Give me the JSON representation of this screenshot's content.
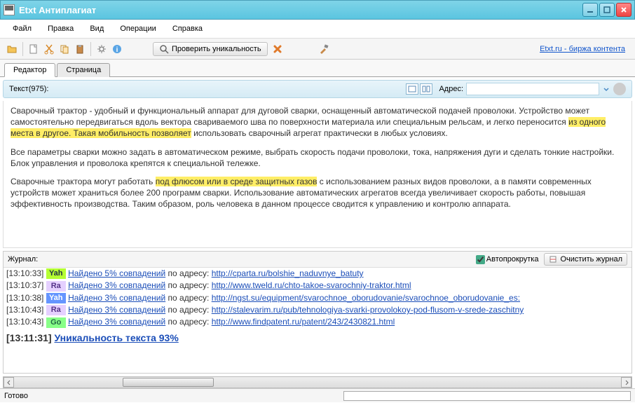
{
  "title": "Etxt Антиплагиат",
  "menubar": [
    "Файл",
    "Правка",
    "Вид",
    "Операции",
    "Справка"
  ],
  "toolbar": {
    "check_label": "Проверить уникальность",
    "etxt_link": "Etxt.ru - биржа контента"
  },
  "tabs": [
    {
      "label": "Редактор",
      "active": true
    },
    {
      "label": "Страница",
      "active": false
    }
  ],
  "editor_header": {
    "text_count": "Текст(975):",
    "addr_label": "Адрес:",
    "addr_value": ""
  },
  "editor_text": {
    "p1_a": "Сварочный трактор - удобный и функциональный аппарат для дуговой сварки, оснащенный автоматической подачей проволоки. Устройство может самостоятельно передвигаться вдоль вектора свариваемого шва по поверхности материала или специальным рельсам, и легко переносится ",
    "p1_hl": "из одного места в другое. Такая мобильность позволяет",
    "p1_b": " использовать сварочный агрегат практически в любых условиях.",
    "p2": "Все параметры сварки можно задать в автоматическом режиме, выбрать скорость подачи проволоки, тока, напряжения дуги и сделать тонкие настройки. Блок управления и проволока крепятся к специальной тележке.",
    "p3_a": "Сварочные трактора могут работать ",
    "p3_hl": "под флюсом или в среде защитных газов",
    "p3_b": " с использованием разных видов проволоки, а в памяти современных устройств может храниться более 200 программ сварки. Использование автоматических агрегатов всегда увеличивает скорость работы, повышая эффективность производства. Таким образом, роль человека в данном процессе сводится к управлению и контролю аппарата."
  },
  "log": {
    "label": "Журнал:",
    "autoscroll_label": "Автопрокрутка",
    "clear_label": "Очистить журнал",
    "по_адресу": " по адресу: ",
    "entries": [
      {
        "ts": "[13:10:33]",
        "engine": "Yah",
        "engine_cls": "yah",
        "found": "Найдено 5% совпадений",
        "url": "http://cparta.ru/bolshie_naduvnye_batuty"
      },
      {
        "ts": "[13:10:37]",
        "engine": "Ra",
        "engine_cls": "ra",
        "found": "Найдено 3% совпадений",
        "url": "http://www.tweld.ru/chto-takoe-svarochniy-traktor.html"
      },
      {
        "ts": "[13:10:38]",
        "engine": "Yah",
        "engine_cls": "yah2",
        "found": "Найдено 3% совпадений",
        "url": "http://ngst.su/equipment/svarochnoe_oborudovanie/svarochnoe_oborudovanie_es:"
      },
      {
        "ts": "[13:10:43]",
        "engine": "Ra",
        "engine_cls": "ra",
        "found": "Найдено 3% совпадений",
        "url": "http://stalevarim.ru/pub/tehnologiya-svarki-provolokoy-pod-flusom-v-srede-zaschitny"
      },
      {
        "ts": "[13:10:43]",
        "engine": "Go",
        "engine_cls": "go",
        "found": "Найдено 3% совпадений",
        "url": "http://www.findpatent.ru/patent/243/2430821.html"
      }
    ],
    "unique": {
      "ts": "[13:11:31]",
      "text": "Уникальность текста 93%"
    }
  },
  "status": "Готово"
}
